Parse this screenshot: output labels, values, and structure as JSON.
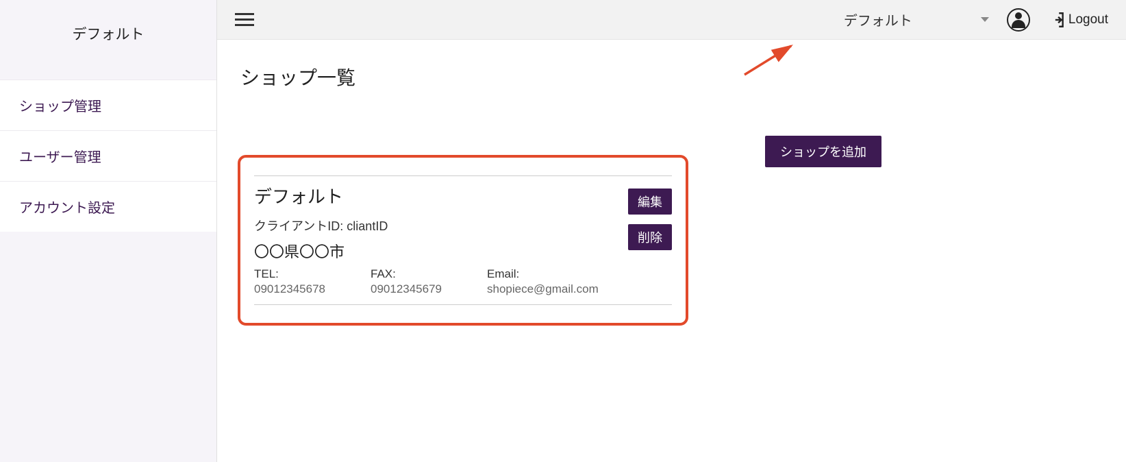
{
  "sidebar": {
    "title": "デフォルト",
    "items": [
      {
        "label": "ショップ管理"
      },
      {
        "label": "ユーザー管理"
      },
      {
        "label": "アカウント設定"
      }
    ]
  },
  "topbar": {
    "shop_selected": "デフォルト",
    "logout_label": "Logout"
  },
  "page": {
    "title": "ショップ一覧",
    "add_shop_label": "ショップを追加"
  },
  "shop_card": {
    "name": "デフォルト",
    "client_id_label": "クライアントID:",
    "client_id_value": "cliantID",
    "address": "〇〇県〇〇市",
    "tel_label": "TEL:",
    "tel_value": "09012345678",
    "fax_label": "FAX:",
    "fax_value": "09012345679",
    "email_label": "Email:",
    "email_value": "shopiece@gmail.com",
    "edit_label": "編集",
    "delete_label": "削除"
  },
  "colors": {
    "accent": "#3d1a52",
    "highlight": "#e24a2b"
  }
}
